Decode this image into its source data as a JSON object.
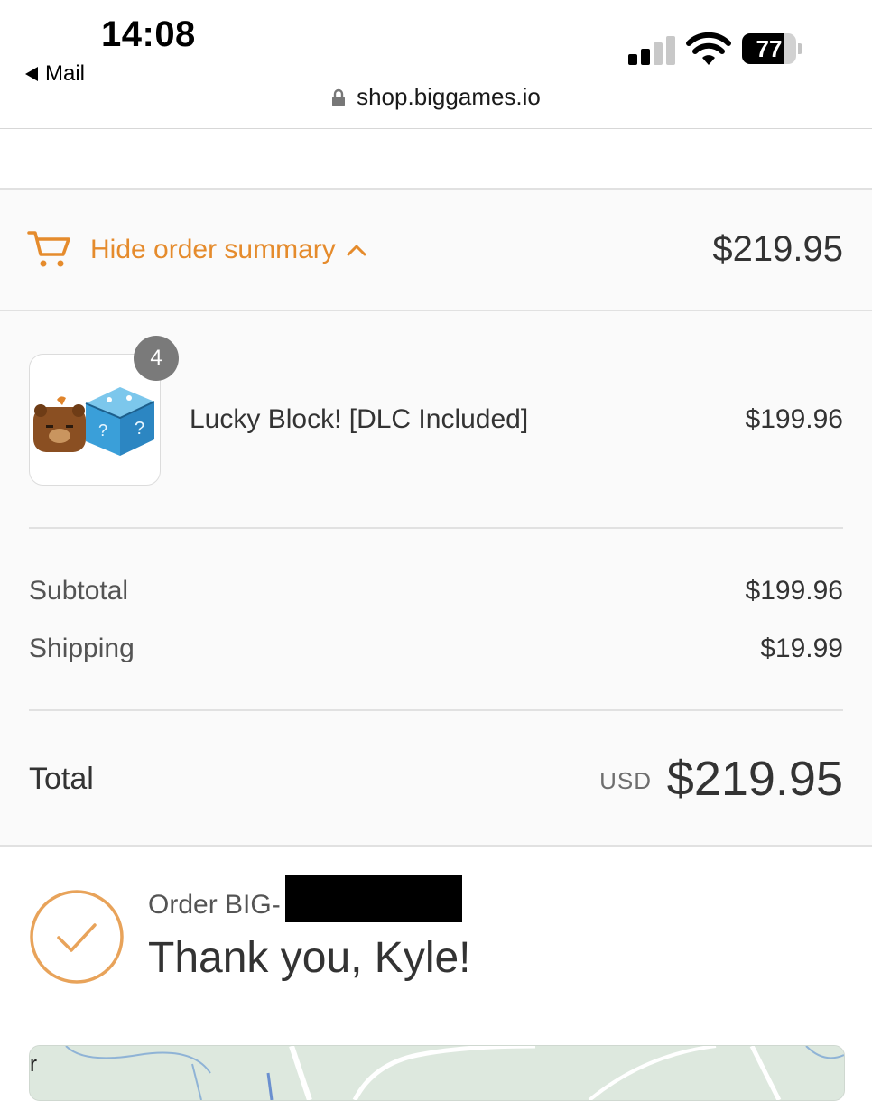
{
  "status_bar": {
    "time": "14:08",
    "back_app": "Mail",
    "battery": "77",
    "url": "shop.biggames.io"
  },
  "summary": {
    "toggle_label": "Hide order summary",
    "toggle_total": "$219.95",
    "product": {
      "quantity": "4",
      "name": "Lucky Block! [DLC Included]",
      "price": "$199.96"
    },
    "subtotal_label": "Subtotal",
    "subtotal_value": "$199.96",
    "shipping_label": "Shipping",
    "shipping_value": "$19.99",
    "total_label": "Total",
    "currency": "USD",
    "total_value": "$219.95"
  },
  "confirmation": {
    "order_prefix": "Order BIG-",
    "thank_you": "Thank you, Kyle!"
  },
  "map": {
    "edge_text": "r"
  },
  "colors": {
    "accent": "#e58b2c",
    "background": "#fafafa",
    "divider": "#e1e1e1",
    "text": "#333333"
  },
  "icons": [
    "back-triangle-icon",
    "signal-icon",
    "wifi-icon",
    "battery-icon",
    "lock-icon",
    "cart-icon",
    "chevron-up-icon",
    "checkmark-circle-icon"
  ]
}
